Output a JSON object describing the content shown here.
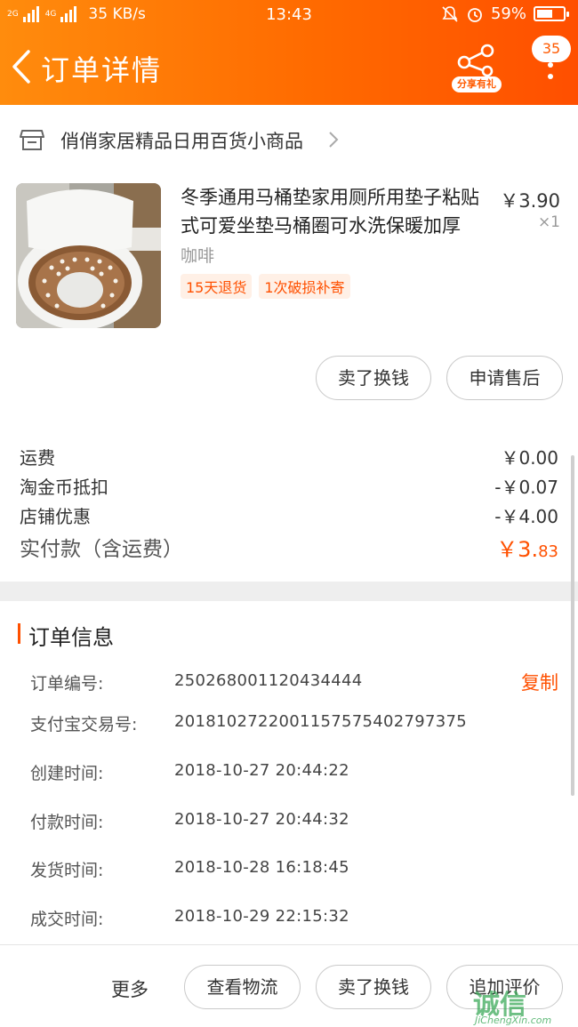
{
  "status_bar": {
    "signal1": "2G",
    "signal2": "4G",
    "net_speed": "35 KB/s",
    "time": "13:43",
    "battery": "59%",
    "battery_level": 0.59
  },
  "header": {
    "title": "订单详情",
    "share_label": "分享有礼",
    "message_count": "35"
  },
  "shop": {
    "name": "俏俏家居精品日用百货小商品"
  },
  "product": {
    "title": "冬季通用马桶垫家用厕所用垫子粘贴式可爱坐垫马桶圈可水洗保暖加厚",
    "sku": "咖啡",
    "price": "￥3.90",
    "quantity": "×1",
    "tags": [
      "15天退货",
      "1次破损补寄"
    ]
  },
  "item_actions": {
    "sell": "卖了换钱",
    "aftersale": "申请售后"
  },
  "fees": [
    {
      "label": "运费",
      "value": "￥0.00"
    },
    {
      "label": "淘金币抵扣",
      "value": "-￥0.07"
    },
    {
      "label": "店铺优惠",
      "value": "-￥4.00"
    }
  ],
  "total": {
    "label": "实付款（含运费）",
    "main": "￥3.",
    "cents": "83"
  },
  "order_info": {
    "title": "订单信息",
    "copy": "复制",
    "rows": [
      {
        "key": "订单编号:",
        "value": "250268001120434444"
      },
      {
        "key": "支付宝交易号:",
        "value": "2018102722001157575402797375"
      },
      {
        "key": "创建时间:",
        "value": "2018-10-27  20:44:22"
      },
      {
        "key": "付款时间:",
        "value": "2018-10-27  20:44:32"
      },
      {
        "key": "发货时间:",
        "value": "2018-10-28  16:18:45"
      },
      {
        "key": "成交时间:",
        "value": "2018-10-29  22:15:32"
      }
    ]
  },
  "bottom_bar": {
    "more": "更多",
    "logistics": "查看物流",
    "sell": "卖了换钱",
    "review": "追加评价"
  },
  "watermark": {
    "big": "诚信",
    "small": "JiChengXin.com"
  },
  "colors": {
    "accent": "#ff5000",
    "header_start": "#ff8c0d",
    "header_end": "#ff4f00"
  }
}
